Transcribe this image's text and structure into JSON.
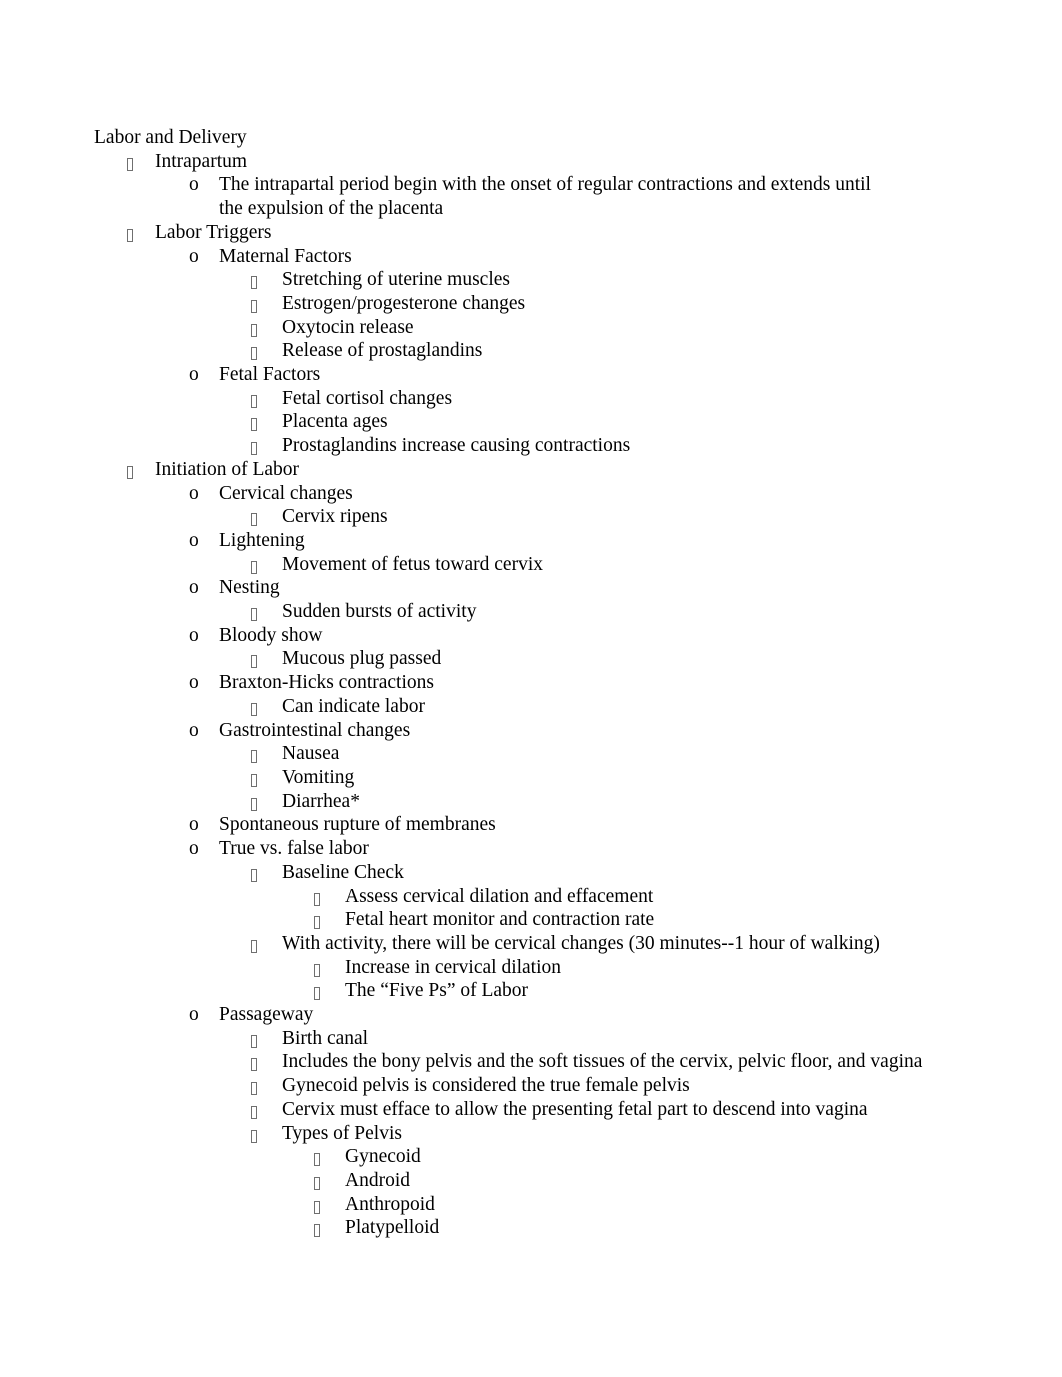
{
  "document": {
    "title": "Labor and Delivery",
    "bullet_glyphs": {
      "level1": "missing-glyph-box",
      "level2": "o",
      "level3": "missing-glyph-box",
      "level4": "missing-glyph-box"
    },
    "colors": {
      "text": "#000000",
      "bullet_box_border": "#6f6f6f",
      "page_background": "#ffffff"
    }
  },
  "outline": [
    {
      "level": 0,
      "marker": "",
      "text": "Labor and Delivery"
    },
    {
      "level": 1,
      "marker": "box",
      "text": "Intrapartum"
    },
    {
      "level": 2,
      "marker": "o",
      "wrap": true,
      "text": "The intrapartal period begin with the onset of regular contractions and extends until the expulsion of the placenta"
    },
    {
      "level": 1,
      "marker": "box",
      "text": "Labor Triggers"
    },
    {
      "level": 2,
      "marker": "o",
      "text": "Maternal Factors"
    },
    {
      "level": 3,
      "marker": "box",
      "text": "Stretching of uterine muscles"
    },
    {
      "level": 3,
      "marker": "box",
      "text": "Estrogen/progesterone changes"
    },
    {
      "level": 3,
      "marker": "box",
      "text": "Oxytocin release"
    },
    {
      "level": 3,
      "marker": "box",
      "text": "Release of prostaglandins"
    },
    {
      "level": 2,
      "marker": "o",
      "text": "Fetal Factors"
    },
    {
      "level": 3,
      "marker": "box",
      "text": "Fetal cortisol changes"
    },
    {
      "level": 3,
      "marker": "box",
      "text": "Placenta ages"
    },
    {
      "level": 3,
      "marker": "box",
      "text": "Prostaglandins increase causing contractions"
    },
    {
      "level": 1,
      "marker": "box",
      "text": "Initiation of Labor"
    },
    {
      "level": 2,
      "marker": "o",
      "text": "Cervical changes"
    },
    {
      "level": 3,
      "marker": "box",
      "text": "Cervix ripens"
    },
    {
      "level": 2,
      "marker": "o",
      "text": "Lightening"
    },
    {
      "level": 3,
      "marker": "box",
      "text": "Movement of fetus toward cervix"
    },
    {
      "level": 2,
      "marker": "o",
      "text": "Nesting"
    },
    {
      "level": 3,
      "marker": "box",
      "text": "Sudden bursts of activity"
    },
    {
      "level": 2,
      "marker": "o",
      "text": "Bloody show"
    },
    {
      "level": 3,
      "marker": "box",
      "text": "Mucous plug passed"
    },
    {
      "level": 2,
      "marker": "o",
      "text": "Braxton-Hicks contractions"
    },
    {
      "level": 3,
      "marker": "box",
      "text": "Can indicate labor"
    },
    {
      "level": 2,
      "marker": "o",
      "text": "Gastrointestinal changes"
    },
    {
      "level": 3,
      "marker": "box",
      "text": "Nausea"
    },
    {
      "level": 3,
      "marker": "box",
      "text": "Vomiting"
    },
    {
      "level": 3,
      "marker": "box",
      "text": "Diarrhea*"
    },
    {
      "level": 2,
      "marker": "o",
      "text": "Spontaneous rupture of membranes"
    },
    {
      "level": 2,
      "marker": "o",
      "text": "True vs. false labor"
    },
    {
      "level": 3,
      "marker": "box",
      "text": "Baseline Check"
    },
    {
      "level": 4,
      "marker": "box",
      "text": "Assess cervical dilation and effacement"
    },
    {
      "level": 4,
      "marker": "box",
      "text": "Fetal heart monitor and contraction rate"
    },
    {
      "level": 3,
      "marker": "box",
      "text": "With activity, there will be cervical changes (30 minutes--1 hour of walking)"
    },
    {
      "level": 4,
      "marker": "box",
      "text": "Increase in cervical dilation"
    },
    {
      "level": 4,
      "marker": "box",
      "text": "The “Five Ps” of Labor"
    },
    {
      "level": 2,
      "marker": "o",
      "text": "Passageway"
    },
    {
      "level": 3,
      "marker": "box",
      "text": "Birth canal"
    },
    {
      "level": 3,
      "marker": "box",
      "text": "Includes the bony pelvis and the soft tissues of the cervix, pelvic floor, and vagina"
    },
    {
      "level": 3,
      "marker": "box",
      "text": "Gynecoid pelvis is considered the true female pelvis"
    },
    {
      "level": 3,
      "marker": "box",
      "text": "Cervix must efface to allow the presenting fetal part to descend into vagina"
    },
    {
      "level": 3,
      "marker": "box",
      "text": "Types of Pelvis"
    },
    {
      "level": 4,
      "marker": "box",
      "text": "Gynecoid"
    },
    {
      "level": 4,
      "marker": "box",
      "text": "Android"
    },
    {
      "level": 4,
      "marker": "box",
      "text": "Anthropoid"
    },
    {
      "level": 4,
      "marker": "box",
      "text": "Platypelloid"
    }
  ]
}
